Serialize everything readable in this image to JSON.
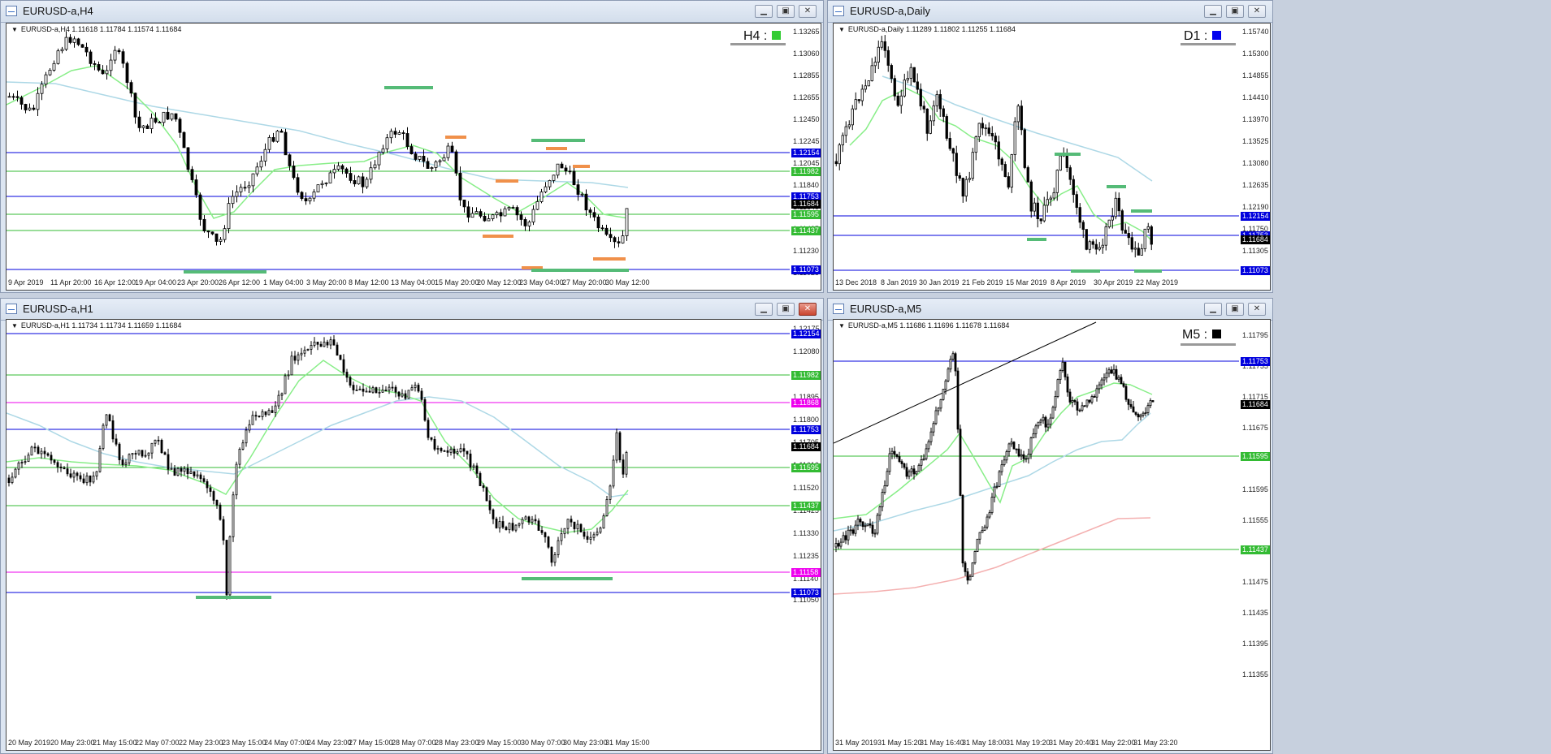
{
  "windows": [
    {
      "id": "h4",
      "title": "EURUSD-a,H4",
      "info": "EURUSD-a,H4  1.11618 1.11784 1.11574 1.11684",
      "tf_label": "H4 :",
      "tf_color": "#33cc33",
      "y_ticks": [
        "1.13265",
        "1.13060",
        "1.12855",
        "1.12655",
        "1.12450",
        "1.12245",
        "1.12045",
        "1.11840",
        "1.11640",
        "1.11435",
        "1.11230",
        "1.11025"
      ],
      "price_labels": [
        {
          "text": "1.12154",
          "color": "#0000dd"
        },
        {
          "text": "1.11982",
          "color": "#33bb33"
        },
        {
          "text": "1.11753",
          "color": "#0000dd"
        },
        {
          "text": "1.11684",
          "color": "#000000"
        },
        {
          "text": "1.11595",
          "color": "#33bb33"
        },
        {
          "text": "1.11437",
          "color": "#33bb33"
        },
        {
          "text": "1.11073",
          "color": "#0000dd"
        }
      ],
      "x_ticks": [
        "9 Apr 2019",
        "11 Apr 20:00",
        "16 Apr 12:00",
        "19 Apr 04:00",
        "23 Apr 20:00",
        "26 Apr 12:00",
        "1 May 04:00",
        "3 May 20:00",
        "8 May 12:00",
        "13 May 04:00",
        "15 May 20:00",
        "20 May 12:00",
        "23 May 04:00",
        "27 May 20:00",
        "30 May 12:00"
      ],
      "window_buttons": [
        "minimize",
        "maximize",
        "close"
      ]
    },
    {
      "id": "d1",
      "title": "EURUSD-a,Daily",
      "info": "EURUSD-a,Daily  1.11289 1.11802 1.11255 1.11684",
      "tf_label": "D1 :",
      "tf_color": "#0000ee",
      "y_ticks": [
        "1.15740",
        "1.15300",
        "1.14855",
        "1.14410",
        "1.13970",
        "1.13525",
        "1.13080",
        "1.12635",
        "1.12190",
        "1.11750",
        "1.11305",
        "1.10860"
      ],
      "price_labels": [
        {
          "text": "1.12154",
          "color": "#0000dd"
        },
        {
          "text": "1.11753",
          "color": "#0000dd"
        },
        {
          "text": "1.11684",
          "color": "#000000"
        },
        {
          "text": "1.11073",
          "color": "#0000dd"
        }
      ],
      "x_ticks": [
        "13 Dec 2018",
        "8 Jan 2019",
        "30 Jan 2019",
        "21 Feb 2019",
        "15 Mar 2019",
        "8 Apr 2019",
        "30 Apr 2019",
        "22 May 2019"
      ],
      "window_buttons": [
        "minimize",
        "maximize",
        "close"
      ]
    },
    {
      "id": "h1",
      "title": "EURUSD-a,H1",
      "info": "EURUSD-a,H1  1.11734 1.11734 1.11659 1.11684",
      "tf_label": "",
      "tf_color": "",
      "y_ticks": [
        "1.12175",
        "1.12080",
        "1.11985",
        "1.11895",
        "1.11800",
        "1.11705",
        "1.11610",
        "1.11520",
        "1.11425",
        "1.11330",
        "1.11235",
        "1.11140",
        "1.11050"
      ],
      "price_labels": [
        {
          "text": "1.12154",
          "color": "#0000dd"
        },
        {
          "text": "1.11982",
          "color": "#33bb33"
        },
        {
          "text": "1.11868",
          "color": "#ee00ee"
        },
        {
          "text": "1.11753",
          "color": "#0000dd"
        },
        {
          "text": "1.11684",
          "color": "#000000"
        },
        {
          "text": "1.11595",
          "color": "#33bb33"
        },
        {
          "text": "1.11437",
          "color": "#33bb33"
        },
        {
          "text": "1.11158",
          "color": "#ee00ee"
        },
        {
          "text": "1.11073",
          "color": "#0000dd"
        }
      ],
      "x_ticks": [
        "20 May 2019",
        "20 May 23:00",
        "21 May 15:00",
        "22 May 07:00",
        "22 May 23:00",
        "23 May 15:00",
        "24 May 07:00",
        "24 May 23:00",
        "27 May 15:00",
        "28 May 07:00",
        "28 May 23:00",
        "29 May 15:00",
        "30 May 07:00",
        "30 May 23:00",
        "31 May 15:00"
      ],
      "window_buttons": [
        "minimize",
        "maximize",
        "close"
      ]
    },
    {
      "id": "m5",
      "title": "EURUSD-a,M5",
      "info": "EURUSD-a,M5  1.11686 1.11696 1.11678 1.11684",
      "tf_label": "M5 :",
      "tf_color": "#000000",
      "y_ticks": [
        "1.11795",
        "1.11755",
        "1.11715",
        "1.11675",
        "1.11635",
        "1.11595",
        "1.11555",
        "1.11515",
        "1.11475",
        "1.11435",
        "1.11395",
        "1.11355"
      ],
      "price_labels": [
        {
          "text": "1.11753",
          "color": "#0000dd"
        },
        {
          "text": "1.11684",
          "color": "#000000"
        },
        {
          "text": "1.11595",
          "color": "#33bb33"
        },
        {
          "text": "1.11437",
          "color": "#33bb33"
        }
      ],
      "x_ticks": [
        "31 May 2019",
        "31 May 15:20",
        "31 May 16:40",
        "31 May 18:00",
        "31 May 19:20",
        "31 May 20:40",
        "31 May 22:00",
        "31 May 23:20"
      ],
      "window_buttons": [
        "minimize",
        "maximize",
        "close"
      ]
    }
  ]
}
